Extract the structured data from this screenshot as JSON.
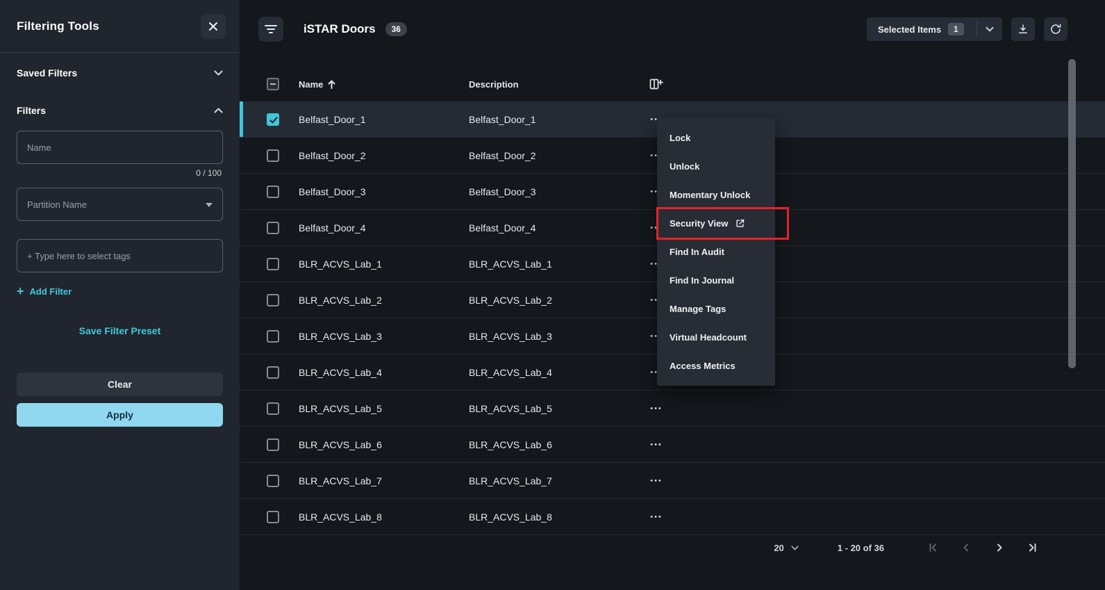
{
  "sidebar": {
    "title": "Filtering Tools",
    "saved_filters_label": "Saved Filters",
    "filters_label": "Filters",
    "name_placeholder": "Name",
    "name_counter": "0 / 100",
    "partition_placeholder": "Partition Name",
    "tags_placeholder": "+ Type here to select tags",
    "add_filter_plus": "+",
    "add_filter_label": "Add Filter",
    "save_preset_label": "Save Filter Preset",
    "clear_label": "Clear",
    "apply_label": "Apply"
  },
  "header": {
    "title": "iSTAR Doors",
    "count_badge": "36",
    "selected_items_label": "Selected Items",
    "selected_count": "1"
  },
  "table": {
    "columns": [
      "Name",
      "Description"
    ],
    "sort": {
      "column": "Name",
      "direction": "asc"
    },
    "rows": [
      {
        "name": "Belfast_Door_1",
        "description": "Belfast_Door_1",
        "selected": true
      },
      {
        "name": "Belfast_Door_2",
        "description": "Belfast_Door_2",
        "selected": false
      },
      {
        "name": "Belfast_Door_3",
        "description": "Belfast_Door_3",
        "selected": false
      },
      {
        "name": "Belfast_Door_4",
        "description": "Belfast_Door_4",
        "selected": false
      },
      {
        "name": "BLR_ACVS_Lab_1",
        "description": "BLR_ACVS_Lab_1",
        "selected": false
      },
      {
        "name": "BLR_ACVS_Lab_2",
        "description": "BLR_ACVS_Lab_2",
        "selected": false
      },
      {
        "name": "BLR_ACVS_Lab_3",
        "description": "BLR_ACVS_Lab_3",
        "selected": false
      },
      {
        "name": "BLR_ACVS_Lab_4",
        "description": "BLR_ACVS_Lab_4",
        "selected": false
      },
      {
        "name": "BLR_ACVS_Lab_5",
        "description": "BLR_ACVS_Lab_5",
        "selected": false
      },
      {
        "name": "BLR_ACVS_Lab_6",
        "description": "BLR_ACVS_Lab_6",
        "selected": false
      },
      {
        "name": "BLR_ACVS_Lab_7",
        "description": "BLR_ACVS_Lab_7",
        "selected": false
      },
      {
        "name": "BLR_ACVS_Lab_8",
        "description": "BLR_ACVS_Lab_8",
        "selected": false
      }
    ]
  },
  "context_menu": {
    "items": [
      {
        "label": "Lock"
      },
      {
        "label": "Unlock"
      },
      {
        "label": "Momentary Unlock"
      },
      {
        "label": "Security View",
        "external_icon": true,
        "annotated": true
      },
      {
        "label": "Find In Audit"
      },
      {
        "label": "Find In Journal"
      },
      {
        "label": "Manage Tags"
      },
      {
        "label": "Virtual Headcount"
      },
      {
        "label": "Access Metrics"
      }
    ]
  },
  "pagination": {
    "page_size": "20",
    "range_label": "1 - 20 of 36"
  },
  "icons": {
    "ellipsis": "•••"
  },
  "colors": {
    "accent_cyan": "#3FC6DA",
    "apply_button": "#8FD8F0",
    "annotation_red": "#E8212A",
    "sidebar_bg": "#21262E",
    "main_bg": "#14171C"
  }
}
